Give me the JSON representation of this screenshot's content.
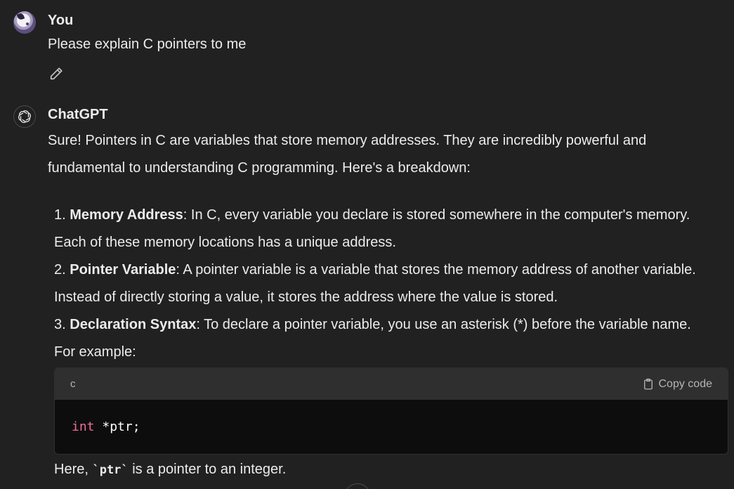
{
  "user_message": {
    "author": "You",
    "text": "Please explain C pointers to me"
  },
  "assistant_message": {
    "author": "ChatGPT",
    "intro": "Sure! Pointers in C are variables that store memory addresses. They are incredibly powerful and fundamental to understanding C programming. Here's a breakdown:",
    "list": [
      {
        "number": "1.",
        "title": "Memory Address",
        "text": ": In C, every variable you declare is stored somewhere in the computer's memory. Each of these memory locations has a unique address."
      },
      {
        "number": "2.",
        "title": "Pointer Variable",
        "text": ": A pointer variable is a variable that stores the memory address of another variable. Instead of directly storing a value, it stores the address where the value is stored."
      },
      {
        "number": "3.",
        "title": "Declaration Syntax",
        "text": ": To declare a pointer variable, you use an asterisk (*) before the variable name. For example:"
      }
    ],
    "code_block": {
      "language": "c",
      "copy_label": "Copy code",
      "keyword": "int",
      "rest": " *ptr;"
    },
    "after_code": {
      "before": "Here, ",
      "code": "`ptr`",
      "after": " is a pointer to an integer."
    }
  },
  "icons": {
    "edit": "pencil-icon",
    "assistant_logo": "openai-logo-icon",
    "copy": "clipboard-icon",
    "user_avatar": "user-avatar-image"
  },
  "colors": {
    "background": "#212121",
    "text": "#ececec",
    "code_header": "#2f2f2f",
    "code_body": "#0d0d0d",
    "keyword": "#f06c9a"
  }
}
